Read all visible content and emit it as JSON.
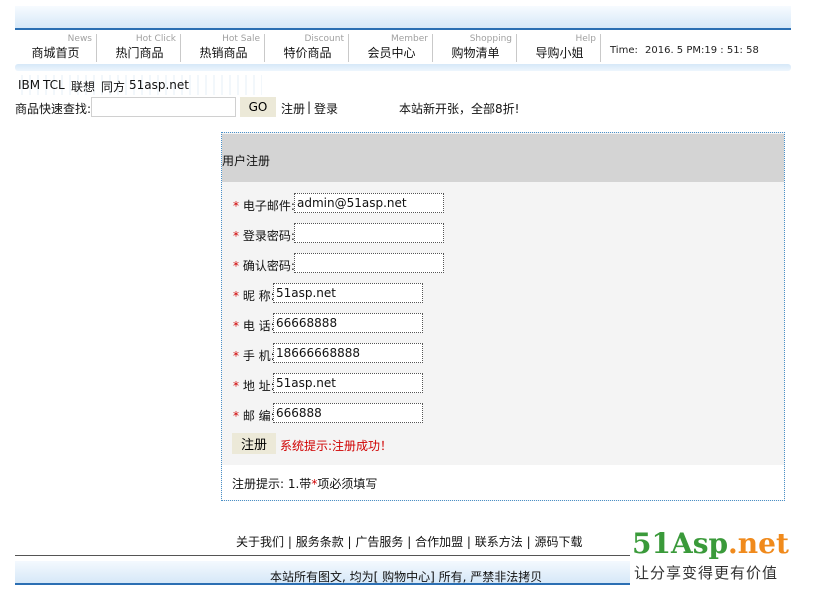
{
  "nav": {
    "items": [
      {
        "en": "News",
        "cn": "商城首页"
      },
      {
        "en": "Hot Click",
        "cn": "热门商品"
      },
      {
        "en": "Hot Sale",
        "cn": "热销商品"
      },
      {
        "en": "Discount",
        "cn": "特价商品"
      },
      {
        "en": "Member",
        "cn": "会员中心"
      },
      {
        "en": "Shopping",
        "cn": "购物清单"
      },
      {
        "en": "Help",
        "cn": "导购小姐"
      }
    ],
    "time_label": "Time:",
    "time_value": "2016. 5 PM:19 :  51:  58"
  },
  "brands": [
    "IBM",
    "TCL",
    "联想",
    "同方",
    "51asp.net"
  ],
  "search": {
    "label": "商品快速查找:",
    "value": "",
    "button": "GO"
  },
  "user_links": {
    "register": "注册",
    "separator": "|",
    "login": "登录"
  },
  "notice": "本站新开张，全部8折!",
  "form": {
    "title": "用户注册",
    "required_mark": "*",
    "fields": [
      {
        "label": "电子邮件:",
        "value": "admin@51asp.net"
      },
      {
        "label": "登录密码:",
        "value": ""
      },
      {
        "label": "确认密码:",
        "value": ""
      },
      {
        "label": "昵 称:",
        "value": "51asp.net"
      },
      {
        "label": "电 话:",
        "value": "66668888"
      },
      {
        "label": "手 机:",
        "value": "18666668888"
      },
      {
        "label": "地 址:",
        "value": "51asp.net"
      },
      {
        "label": "邮 编:",
        "value": "666888"
      }
    ],
    "submit": "注册",
    "success_message": "系统提示:注册成功！",
    "hint_prefix": "注册提示: 1.带",
    "hint_suffix": "项必须填写"
  },
  "footer": {
    "links": [
      "关于我们",
      "服务条款",
      "广告服务",
      "合作加盟",
      "联系方法",
      "源码下载"
    ],
    "separator": " | ",
    "copyright": "本站所有图文, 均为[ 购物中心] 所有, 严禁非法拷贝"
  },
  "watermark": {
    "main_a": "51Asp",
    "main_b": ".net",
    "sub": "让分享变得更有价值"
  },
  "colors": {
    "accent": "#2b6fb3",
    "required": "#d00000",
    "watermark_orange": "#f08a1c",
    "watermark_green": "#3a9a3a"
  }
}
